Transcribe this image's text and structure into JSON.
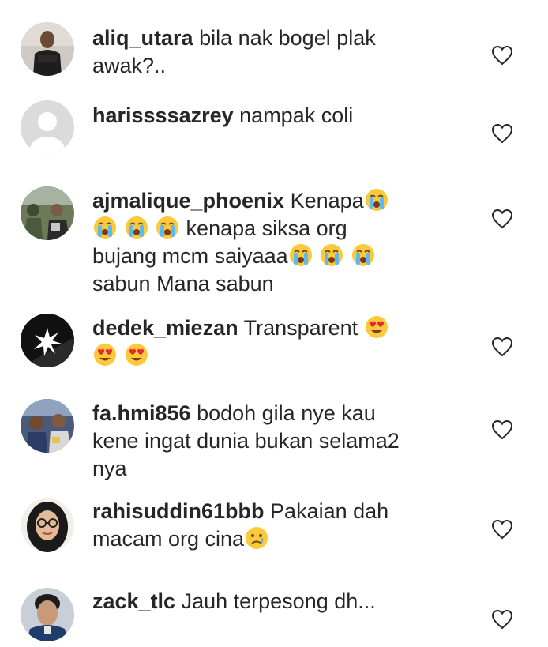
{
  "comments": [
    {
      "username": "aliq_utara",
      "lines": [
        "bila nak bogel plak",
        "awak?.."
      ],
      "emojis": [],
      "avatar": "avatar-man-black-shirt"
    },
    {
      "username": "harissssazrey",
      "lines": [
        "nampak coli"
      ],
      "emojis": [],
      "avatar": "avatar-default"
    },
    {
      "username": "ajmalique_phoenix",
      "lines": [
        "Kenapa",
        "kenapa siksa org",
        "bujang mcm saiyaaa",
        "sabun Mana sabun"
      ],
      "emojis": [
        "crying-face-emoji"
      ],
      "avatar": "avatar-group-photo"
    },
    {
      "username": "dedek_miezan",
      "lines": [
        "Transparent"
      ],
      "emojis": [
        "heart-eyes-emoji"
      ],
      "avatar": "avatar-star-logo"
    },
    {
      "username": "fa.hmi856",
      "lines": [
        "bodoh gila nye kau",
        "kene ingat dunia bukan selama2",
        "nya"
      ],
      "emojis": [],
      "avatar": "avatar-people-photo"
    },
    {
      "username": "rahisuddin61bbb",
      "lines": [
        "Pakaian dah",
        "macam org cina"
      ],
      "emojis": [
        "sad-tear-face-emoji"
      ],
      "avatar": "avatar-woman-glasses"
    },
    {
      "username": "zack_tlc",
      "lines": [
        "Jauh terpesong dh..."
      ],
      "emojis": [],
      "avatar": "avatar-young-man"
    }
  ],
  "icons": {
    "like": "heart-outline-icon"
  },
  "colors": {
    "text": "#262626",
    "heart_outline": "#262626",
    "default_avatar_bg": "#dbdbdb"
  }
}
